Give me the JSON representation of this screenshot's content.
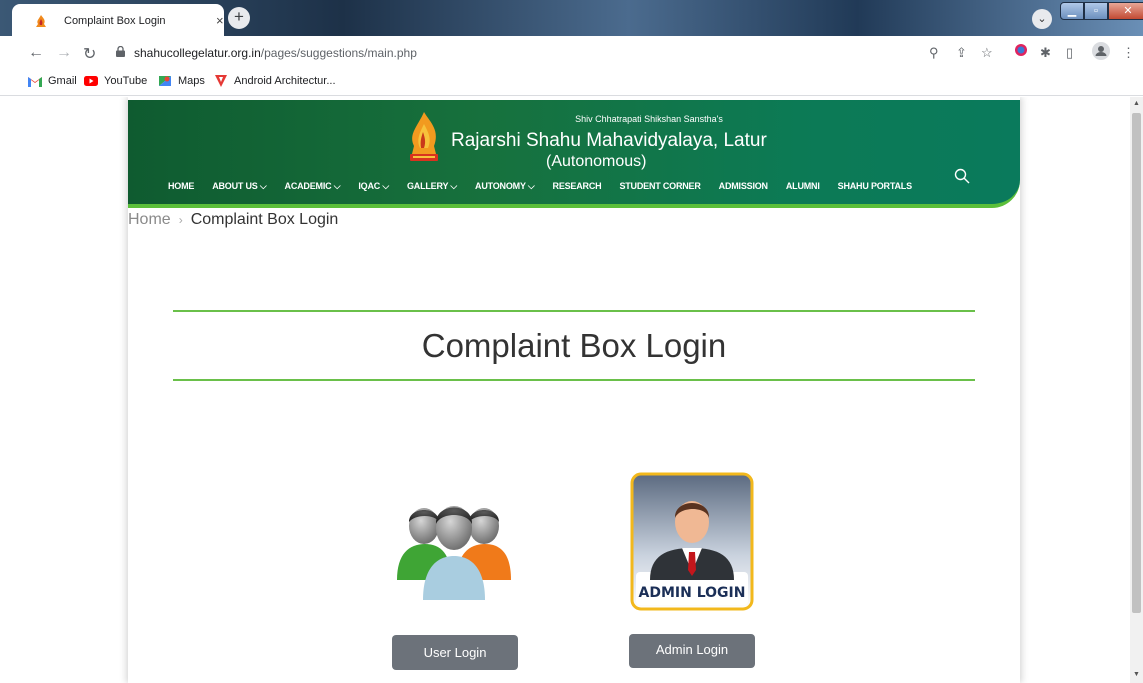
{
  "browser": {
    "tab_title": "Complaint Box Login",
    "tab_close": "×",
    "new_tab": "+",
    "url_host": "shahucollegelatur.org.in",
    "url_path": "/pages/suggestions/main.php",
    "bookmarks": [
      {
        "label": "Gmail",
        "icon": "gmail-icon"
      },
      {
        "label": "YouTube",
        "icon": "youtube-icon"
      },
      {
        "label": "Maps",
        "icon": "maps-icon"
      },
      {
        "label": "Android Architectur...",
        "icon": "android-arch-icon"
      }
    ]
  },
  "header": {
    "sanstha": "Shiv Chhatrapati Shikshan Sanstha's",
    "college": "Rajarshi Shahu Mahavidyalaya, Latur",
    "autonomous": "(Autonomous)",
    "nav": [
      "HOME",
      "ABOUT US ⌵",
      "ACADEMIC ⌵",
      "IQAC ⌵",
      "GALLERY ⌵",
      "AUTONOMY ⌵",
      "RESEARCH",
      "STUDENT CORNER",
      "ADMISSION",
      "ALUMNI",
      "SHAHU PORTALS"
    ]
  },
  "breadcrumb": {
    "home": "Home",
    "separator": "›",
    "current": "Complaint Box Login"
  },
  "main": {
    "heading": "Complaint Box Login",
    "admin_badge_text": "ADMIN LOGIN",
    "user_login_label": "User Login",
    "admin_login_label": "Admin Login"
  },
  "colors": {
    "header_green": "#17713d",
    "accent_green": "#6ac04a",
    "button_gray": "#6c727a"
  }
}
